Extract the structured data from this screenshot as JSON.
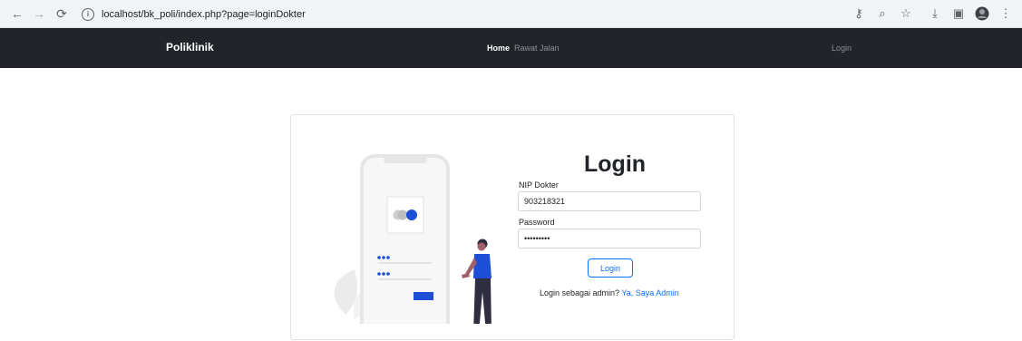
{
  "browser": {
    "url_host": "localhost",
    "url_path": "/bk_poli/index.php?page=loginDokter"
  },
  "navbar": {
    "brand": "Poliklinik",
    "items": [
      {
        "label": "Home",
        "active": true
      },
      {
        "label": "Rawat Jalan",
        "active": false
      }
    ],
    "right_item": "Login"
  },
  "login": {
    "title": "Login",
    "nip_label": "NIP Dokter",
    "nip_value": "903218321",
    "password_label": "Password",
    "password_value": "•••••••••",
    "submit_label": "Login",
    "admin_prompt": "Login sebagai admin?",
    "admin_link": "Ya, Saya Admin"
  },
  "colors": {
    "navbar_bg": "#212529",
    "accent": "#0d6efd",
    "illustration_blue": "#1d4ed8"
  }
}
